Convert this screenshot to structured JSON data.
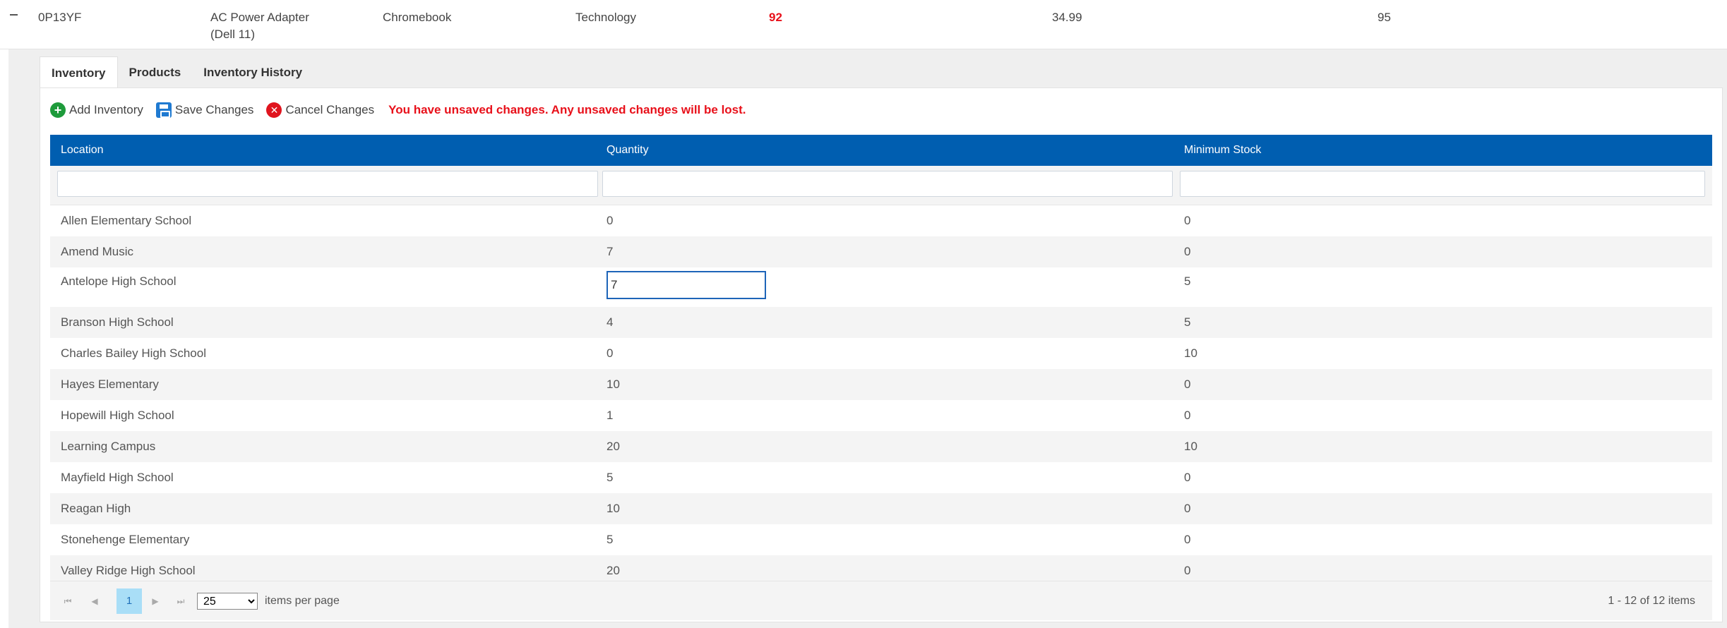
{
  "master_row": {
    "sku": "0P13YF",
    "description_line1": "AC Power Adapter",
    "description_line2": "(Dell 11)",
    "model": "Chromebook",
    "category": "Technology",
    "total_quantity": "92",
    "price": "34.99",
    "total_min": "95"
  },
  "tabs": [
    {
      "label": "Inventory",
      "active": true
    },
    {
      "label": "Products",
      "active": false
    },
    {
      "label": "Inventory History",
      "active": false
    }
  ],
  "toolbar": {
    "add_label": "Add Inventory",
    "save_label": "Save Changes",
    "cancel_label": "Cancel Changes",
    "warning": "You have unsaved changes. Any unsaved changes will be lost."
  },
  "grid": {
    "columns": [
      "Location",
      "Quantity",
      "Minimum Stock"
    ],
    "rows": [
      {
        "location": "Allen Elementary School",
        "quantity": "0",
        "minimum": "0"
      },
      {
        "location": "Amend Music",
        "quantity": "7",
        "minimum": "0"
      },
      {
        "location": "Antelope High School",
        "quantity": "7",
        "minimum": "5",
        "editing": true
      },
      {
        "location": "Branson High School",
        "quantity": "4",
        "minimum": "5"
      },
      {
        "location": "Charles Bailey High School",
        "quantity": "0",
        "minimum": "10"
      },
      {
        "location": "Hayes Elementary",
        "quantity": "10",
        "minimum": "0"
      },
      {
        "location": "Hopewill High School",
        "quantity": "1",
        "minimum": "0"
      },
      {
        "location": "Learning Campus",
        "quantity": "20",
        "minimum": "10"
      },
      {
        "location": "Mayfield High School",
        "quantity": "5",
        "minimum": "0"
      },
      {
        "location": "Reagan High",
        "quantity": "10",
        "minimum": "0"
      },
      {
        "location": "Stonehenge Elementary",
        "quantity": "5",
        "minimum": "0"
      },
      {
        "location": "Valley Ridge High School",
        "quantity": "20",
        "minimum": "0"
      }
    ]
  },
  "pager": {
    "current_page": "1",
    "page_size": "25",
    "page_size_options": [
      "25"
    ],
    "items_per_page_label": "items per page",
    "info": "1 - 12 of 12 items"
  }
}
